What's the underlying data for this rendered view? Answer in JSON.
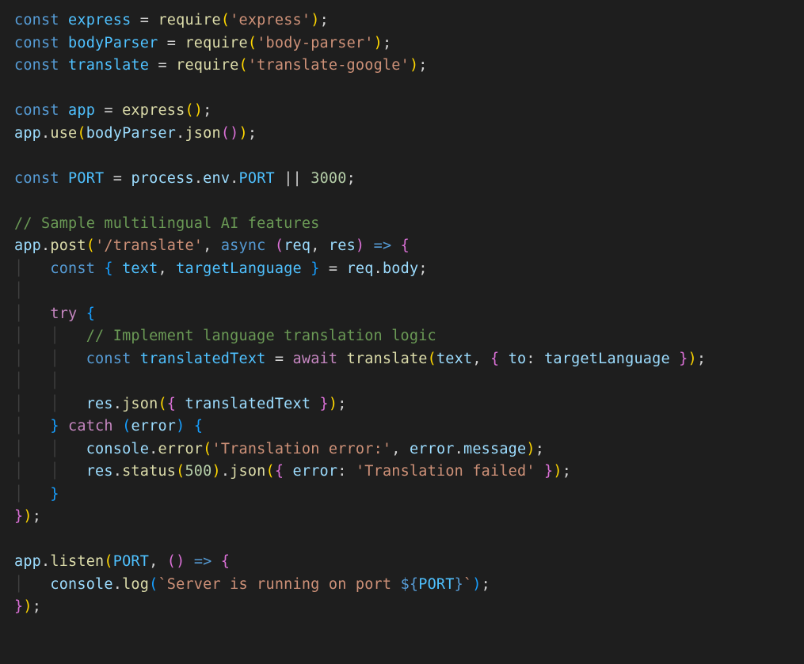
{
  "language": "javascript",
  "theme": "dark",
  "tokens": {
    "kw_const": "const",
    "kw_try": "try",
    "kw_catch": "catch",
    "kw_async": "async",
    "kw_await": "await",
    "fn_require": "require",
    "fn_express_call": "express",
    "fn_use": "use",
    "fn_json": "json",
    "fn_post": "post",
    "fn_translate": "translate",
    "fn_error": "error",
    "fn_status": "status",
    "fn_listen": "listen",
    "fn_log": "log",
    "id_express": "express",
    "id_bodyParser": "bodyParser",
    "id_translate": "translate",
    "id_app": "app",
    "id_PORT": "PORT",
    "id_process": "process",
    "id_env": "env",
    "id_req": "req",
    "id_res": "res",
    "id_text": "text",
    "id_targetLanguage": "targetLanguage",
    "id_body": "body",
    "id_translatedText": "translatedText",
    "id_to": "to",
    "id_error": "error",
    "id_console": "console",
    "id_message": "message",
    "str_express": "'express'",
    "str_bodyparser": "'body-parser'",
    "str_translategoogle": "'translate-google'",
    "str_route": "'/translate'",
    "str_transerr": "'Translation error:'",
    "str_transfail": "'Translation failed'",
    "tmpl_open": "`Server is running on port ",
    "tmpl_close": "`",
    "num_3000": "3000",
    "num_500": "500",
    "cmt_features": "// Sample multilingual AI features",
    "cmt_implement": "// Implement language translation logic"
  }
}
